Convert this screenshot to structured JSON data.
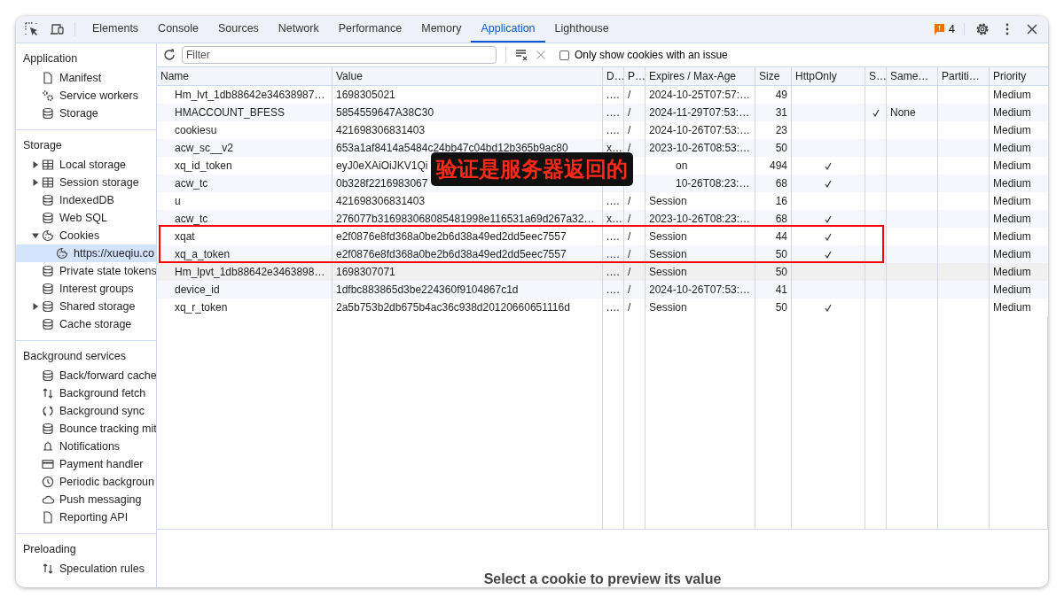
{
  "toolbar_tabs": [
    {
      "label": "Elements",
      "selected": false
    },
    {
      "label": "Console",
      "selected": false
    },
    {
      "label": "Sources",
      "selected": false
    },
    {
      "label": "Network",
      "selected": false
    },
    {
      "label": "Performance",
      "selected": false
    },
    {
      "label": "Memory",
      "selected": false
    },
    {
      "label": "Application",
      "selected": true
    },
    {
      "label": "Lighthouse",
      "selected": false
    }
  ],
  "issues_count": "4",
  "sidebar": [
    {
      "title": "Application",
      "items": [
        {
          "label": "Manifest",
          "selected": false
        },
        {
          "label": "Service workers",
          "selected": false
        },
        {
          "label": "Storage",
          "selected": false
        }
      ]
    },
    {
      "title": "Storage",
      "items": [
        {
          "label": "Local storage",
          "expanded": false,
          "selected": false
        },
        {
          "label": "Session storage",
          "expanded": false,
          "selected": false
        },
        {
          "label": "IndexedDB",
          "selected": false
        },
        {
          "label": "Web SQL",
          "selected": false
        },
        {
          "label": "Cookies",
          "expanded": true,
          "selected": false,
          "children": [
            {
              "label": "https://xueqiu.co",
              "selected": true
            }
          ]
        },
        {
          "label": "Private state tokens",
          "selected": false
        },
        {
          "label": "Interest groups",
          "selected": false
        },
        {
          "label": "Shared storage",
          "expanded": false,
          "selected": false
        },
        {
          "label": "Cache storage",
          "selected": false
        }
      ]
    },
    {
      "title": "Background services",
      "items": [
        {
          "label": "Back/forward cache",
          "selected": false
        },
        {
          "label": "Background fetch",
          "selected": false
        },
        {
          "label": "Background sync",
          "selected": false
        },
        {
          "label": "Bounce tracking mit",
          "selected": false
        },
        {
          "label": "Notifications",
          "selected": false
        },
        {
          "label": "Payment handler",
          "selected": false
        },
        {
          "label": "Periodic backgroun",
          "selected": false
        },
        {
          "label": "Push messaging",
          "selected": false
        },
        {
          "label": "Reporting API",
          "selected": false
        }
      ]
    },
    {
      "title": "Preloading",
      "items": [
        {
          "label": "Speculation rules",
          "selected": false
        }
      ]
    }
  ],
  "filter": {
    "placeholder": "Filter"
  },
  "issue_filter": {
    "label": "Only show cookies with an issue",
    "checked": false
  },
  "table": {
    "columns": [
      "Name",
      "Value",
      "D…",
      "P…",
      "Expires / Max-Age",
      "Size",
      "HttpOnly",
      "S…",
      "Same…",
      "Partiti…",
      "Priority"
    ],
    "rows": [
      {
        "name": "Hm_lvt_1db88642e34638987…",
        "value": "1698305021",
        "domain": ".…",
        "path": "/",
        "expires": "2024-10-25T07:57:…",
        "size": "49",
        "http_only": false,
        "secure": false,
        "same_site": "",
        "priority": "Medium",
        "highlighted": false,
        "framed": false
      },
      {
        "name": "HMACCOUNT_BFESS",
        "value": "5854559647A38C30",
        "domain": ".…",
        "path": "/",
        "expires": "2024-11-29T07:53:…",
        "size": "31",
        "http_only": false,
        "secure": true,
        "same_site": "None",
        "priority": "Medium",
        "highlighted": false,
        "framed": false
      },
      {
        "name": "cookiesu",
        "value": "421698306831403",
        "domain": ".…",
        "path": "/",
        "expires": "2024-10-26T07:53:…",
        "size": "23",
        "http_only": false,
        "secure": false,
        "same_site": "",
        "priority": "Medium",
        "highlighted": false,
        "framed": false
      },
      {
        "name": "acw_sc__v2",
        "value": "653a1af8414a5484c24bb47c04bd12b365b9ac80",
        "domain": "x…",
        "path": "/",
        "expires": "2023-10-26T08:53:…",
        "size": "50",
        "http_only": false,
        "secure": false,
        "same_site": "",
        "priority": "Medium",
        "highlighted": false,
        "framed": false
      },
      {
        "name": "xq_id_token",
        "value": "eyJ0eXAiOiJKV1Qi",
        "domain": "",
        "path": "",
        "expires": "on",
        "expires_after_note": true,
        "size": "494",
        "http_only": true,
        "secure": false,
        "same_site": "",
        "priority": "Medium",
        "highlighted": false,
        "framed": false
      },
      {
        "name": "acw_tc",
        "value": "0b328f2216983067",
        "domain": "",
        "path": "",
        "expires": "10-26T08:23:…",
        "expires_after_note": true,
        "size": "68",
        "http_only": true,
        "secure": false,
        "same_site": "",
        "priority": "Medium",
        "highlighted": false,
        "framed": false
      },
      {
        "name": "u",
        "value": "421698306831403",
        "domain": ".…",
        "path": "/",
        "expires": "Session",
        "size": "16",
        "http_only": false,
        "secure": false,
        "same_site": "",
        "priority": "Medium",
        "highlighted": false,
        "framed": false
      },
      {
        "name": "acw_tc",
        "value": "276077b316983068085481998e116531a69d267a32…",
        "domain": "x…",
        "path": "/",
        "expires": "2023-10-26T08:23:…",
        "size": "68",
        "http_only": true,
        "secure": false,
        "same_site": "",
        "priority": "Medium",
        "highlighted": false,
        "framed": false
      },
      {
        "name": "xqat",
        "value": "e2f0876e8fd368a0be2b6d38a49ed2dd5eec7557",
        "domain": ".…",
        "path": "/",
        "expires": "Session",
        "size": "44",
        "http_only": true,
        "secure": false,
        "same_site": "",
        "priority": "Medium",
        "highlighted": false,
        "framed": true
      },
      {
        "name": "xq_a_token",
        "value": "e2f0876e8fd368a0be2b6d38a49ed2dd5eec7557",
        "domain": ".…",
        "path": "/",
        "expires": "Session",
        "size": "50",
        "http_only": true,
        "secure": false,
        "same_site": "",
        "priority": "Medium",
        "highlighted": false,
        "framed": true
      },
      {
        "name": "Hm_lpvt_1db88642e3463898…",
        "value": "1698307071",
        "domain": ".…",
        "path": "/",
        "expires": "Session",
        "size": "50",
        "http_only": false,
        "secure": false,
        "same_site": "",
        "priority": "Medium",
        "highlighted": true,
        "framed": false
      },
      {
        "name": "device_id",
        "value": "1dfbc883865d3be224360f9104867c1d",
        "domain": ".…",
        "path": "/",
        "expires": "2024-10-26T07:53:…",
        "size": "41",
        "http_only": false,
        "secure": false,
        "same_site": "",
        "priority": "Medium",
        "highlighted": false,
        "framed": false
      },
      {
        "name": "xq_r_token",
        "value": "2a5b753b2db675b4ac36c938d20120660651116d",
        "domain": ".…",
        "path": "/",
        "expires": "Session",
        "size": "50",
        "http_only": true,
        "secure": false,
        "same_site": "",
        "priority": "Medium",
        "highlighted": false,
        "framed": false
      }
    ]
  },
  "annotation": {
    "label": "验证是服务器返回的"
  },
  "preview": {
    "message": "Select a cookie to preview its value"
  }
}
